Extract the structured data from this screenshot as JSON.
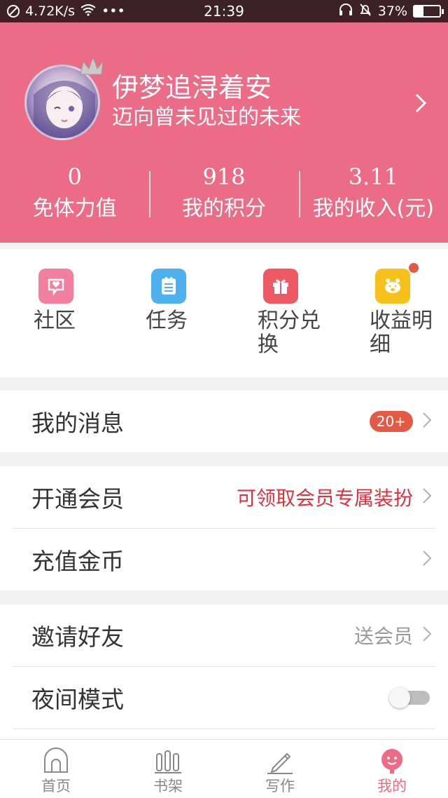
{
  "status": {
    "speed": "4.72K/s",
    "dots": "•••",
    "time": "21:39",
    "battery": "37%",
    "battery_level": 0.37
  },
  "profile": {
    "name": "伊梦追浔着安",
    "motto": "迈向曾未见过的未来"
  },
  "stats": [
    {
      "value": "0",
      "label": "免体力值"
    },
    {
      "value": "918",
      "label": "我的积分"
    },
    {
      "value": "3.11",
      "label": "我的收入(元)"
    }
  ],
  "shortcuts": [
    {
      "label": "社区",
      "icon": "community-heart-icon",
      "color": "#f27ea0"
    },
    {
      "label": "任务",
      "icon": "task-list-icon",
      "color": "#4fb0ee"
    },
    {
      "label": "积分兑换",
      "icon": "gift-icon",
      "color": "#ee5966"
    },
    {
      "label": "收益明细",
      "icon": "piggy-bank-icon",
      "color": "#f8c01a"
    }
  ],
  "menu": {
    "messages": {
      "label": "我的消息",
      "badge": "20+"
    },
    "vip": {
      "label": "开通会员",
      "promo": "可领取会员专属装扮"
    },
    "recharge": {
      "label": "充值金币"
    },
    "invite": {
      "label": "邀请好友",
      "hint": "送会员"
    },
    "night_mode": {
      "label": "夜间模式",
      "enabled": false
    }
  },
  "tabs": [
    {
      "label": "首页",
      "icon": "home-icon"
    },
    {
      "label": "书架",
      "icon": "bookshelf-icon"
    },
    {
      "label": "写作",
      "icon": "pen-icon"
    },
    {
      "label": "我的",
      "icon": "profile-icon",
      "active": true
    }
  ],
  "colors": {
    "brand": "#ec6b87",
    "status_bar": "#3d2126",
    "badge": "#e05a45",
    "promo": "#e0303e"
  }
}
